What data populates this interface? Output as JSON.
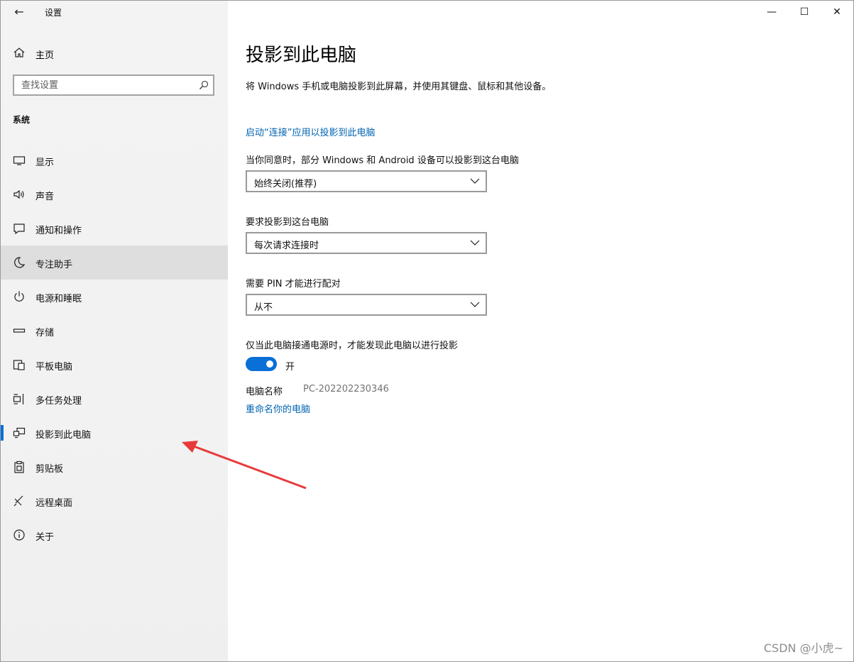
{
  "window": {
    "back_label": "←",
    "title": "设置",
    "controls": {
      "minimize": "—",
      "maximize": "☐",
      "close": "✕"
    }
  },
  "sidebar": {
    "home_label": "主页",
    "search": {
      "placeholder": "查找设置"
    },
    "section_label": "系统",
    "items": [
      {
        "label": "显示",
        "icon": "display-icon"
      },
      {
        "label": "声音",
        "icon": "speaker-icon"
      },
      {
        "label": "通知和操作",
        "icon": "notification-icon"
      },
      {
        "label": "专注助手",
        "icon": "moon-icon",
        "state": "hover"
      },
      {
        "label": "电源和睡眠",
        "icon": "power-icon"
      },
      {
        "label": "存储",
        "icon": "storage-icon"
      },
      {
        "label": "平板电脑",
        "icon": "tablet-icon"
      },
      {
        "label": "多任务处理",
        "icon": "multitask-icon"
      },
      {
        "label": "投影到此电脑",
        "icon": "project-icon",
        "state": "selected"
      },
      {
        "label": "剪贴板",
        "icon": "clipboard-icon"
      },
      {
        "label": "远程桌面",
        "icon": "remote-icon"
      },
      {
        "label": "关于",
        "icon": "info-icon"
      }
    ]
  },
  "main": {
    "title": "投影到此电脑",
    "description": "将 Windows 手机或电脑投影到此屏幕，并使用其键盘、鼠标和其他设备。",
    "connect_link": "启动“连接”应用以投影到此电脑",
    "settings": [
      {
        "label": "当你同意时，部分 Windows 和 Android 设备可以投影到这台电脑",
        "value": "始终关闭(推荐)"
      },
      {
        "label": "要求投影到这台电脑",
        "value": "每次请求连接时"
      },
      {
        "label": "需要 PIN 才能进行配对",
        "value": "从不"
      }
    ],
    "power_toggle": {
      "label": "仅当此电脑接通电源时，才能发现此电脑以进行投影",
      "state": "开",
      "on": true
    },
    "pc_name": {
      "label": "电脑名称",
      "value": "PC-202202230346"
    },
    "rename_link": "重命名你的电脑"
  },
  "watermark": "CSDN @小虎~",
  "colors": {
    "accent": "#0a6fd6",
    "link": "#0063b1",
    "arrow": "#e83a3a",
    "nav_bg": "#f2f2f2",
    "hover_bg": "#dedede"
  }
}
